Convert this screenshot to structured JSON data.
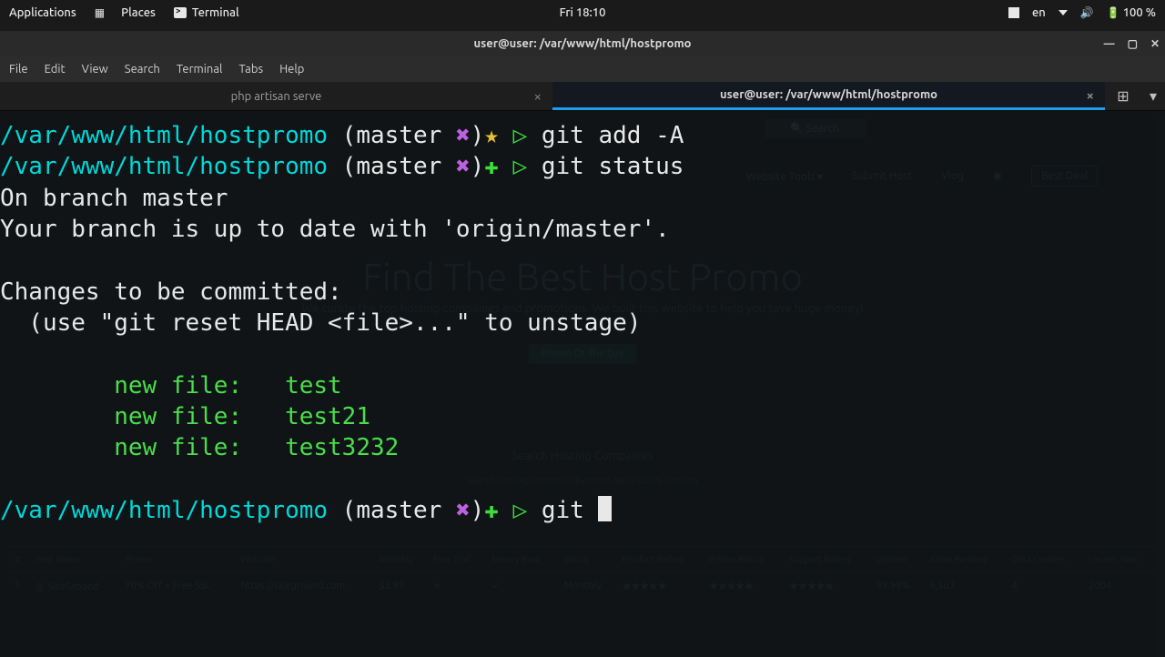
{
  "panel": {
    "applications": "Applications",
    "places": "Places",
    "active_app": "Terminal",
    "clock": "Fri 18:10",
    "lang": "en",
    "battery": "100 %"
  },
  "window": {
    "title": "user@user: /var/www/html/hostpromo",
    "min": "—",
    "max": "▢",
    "close": "✕"
  },
  "menubar": [
    "File",
    "Edit",
    "View",
    "Search",
    "Terminal",
    "Tabs",
    "Help"
  ],
  "tabs": {
    "items": [
      {
        "label": "php artisan serve",
        "active": false
      },
      {
        "label": "user@user: /var/www/html/hostpromo",
        "active": true
      }
    ],
    "add": "⊞",
    "menu": "▾"
  },
  "prompt": {
    "path": "/var/www/html/hostpromo",
    "branch_open": " (",
    "branch": "master",
    "branch_close": ")",
    "x": "✖",
    "star": "★",
    "plus": "✚",
    "arrow": "▷"
  },
  "term": {
    "cmd1": "git add -A",
    "cmd2": "git status",
    "l_onbranch": "On branch master",
    "l_uptodate": "Your branch is up to date with 'origin/master'.",
    "l_blank": "",
    "l_changes": "Changes to be committed:",
    "l_unstage": "  (use \"git reset HEAD <file>...\" to unstage)",
    "nf1": "        new file:   test",
    "nf2": "        new file:   test21",
    "nf3": "        new file:   test3232",
    "cmd3": "git "
  },
  "bg": {
    "search": "Search",
    "nav": {
      "tools": "Website Tools ▾",
      "submit": "Submit Host",
      "vlog": "Vlog",
      "deal": "Best Deal"
    },
    "hero": "Find The Best Host Promo",
    "sub": "We curate the top hosting companies and promotions. We built this website to help you save huge money!",
    "promo_btn": "Promo Of The Day",
    "search_ph": "Search Hosting Companies",
    "search_help": "Search hosting companies by name, description, location",
    "columns": [
      "#",
      "Host Name",
      "Promo",
      "Website",
      "Monthly",
      "Free Trial",
      "Money Back",
      "Billing",
      "Product Rating",
      "Promo Rating",
      "Support Rating",
      "Uptime",
      "Alexa Ranking",
      "Data Centers",
      "Launch Year"
    ],
    "row": {
      "n": "1",
      "host": "SiteGround",
      "promo": "70% Off + Free SSL",
      "site": "https://siteground.com",
      "monthly": "$3.95",
      "trial": "✕",
      "moneyback": "✓",
      "billing": "Monthly",
      "stars": "★★★★★",
      "uptime": "99.99%",
      "alexa": "6,503",
      "dc": "4",
      "year": "2004"
    }
  }
}
